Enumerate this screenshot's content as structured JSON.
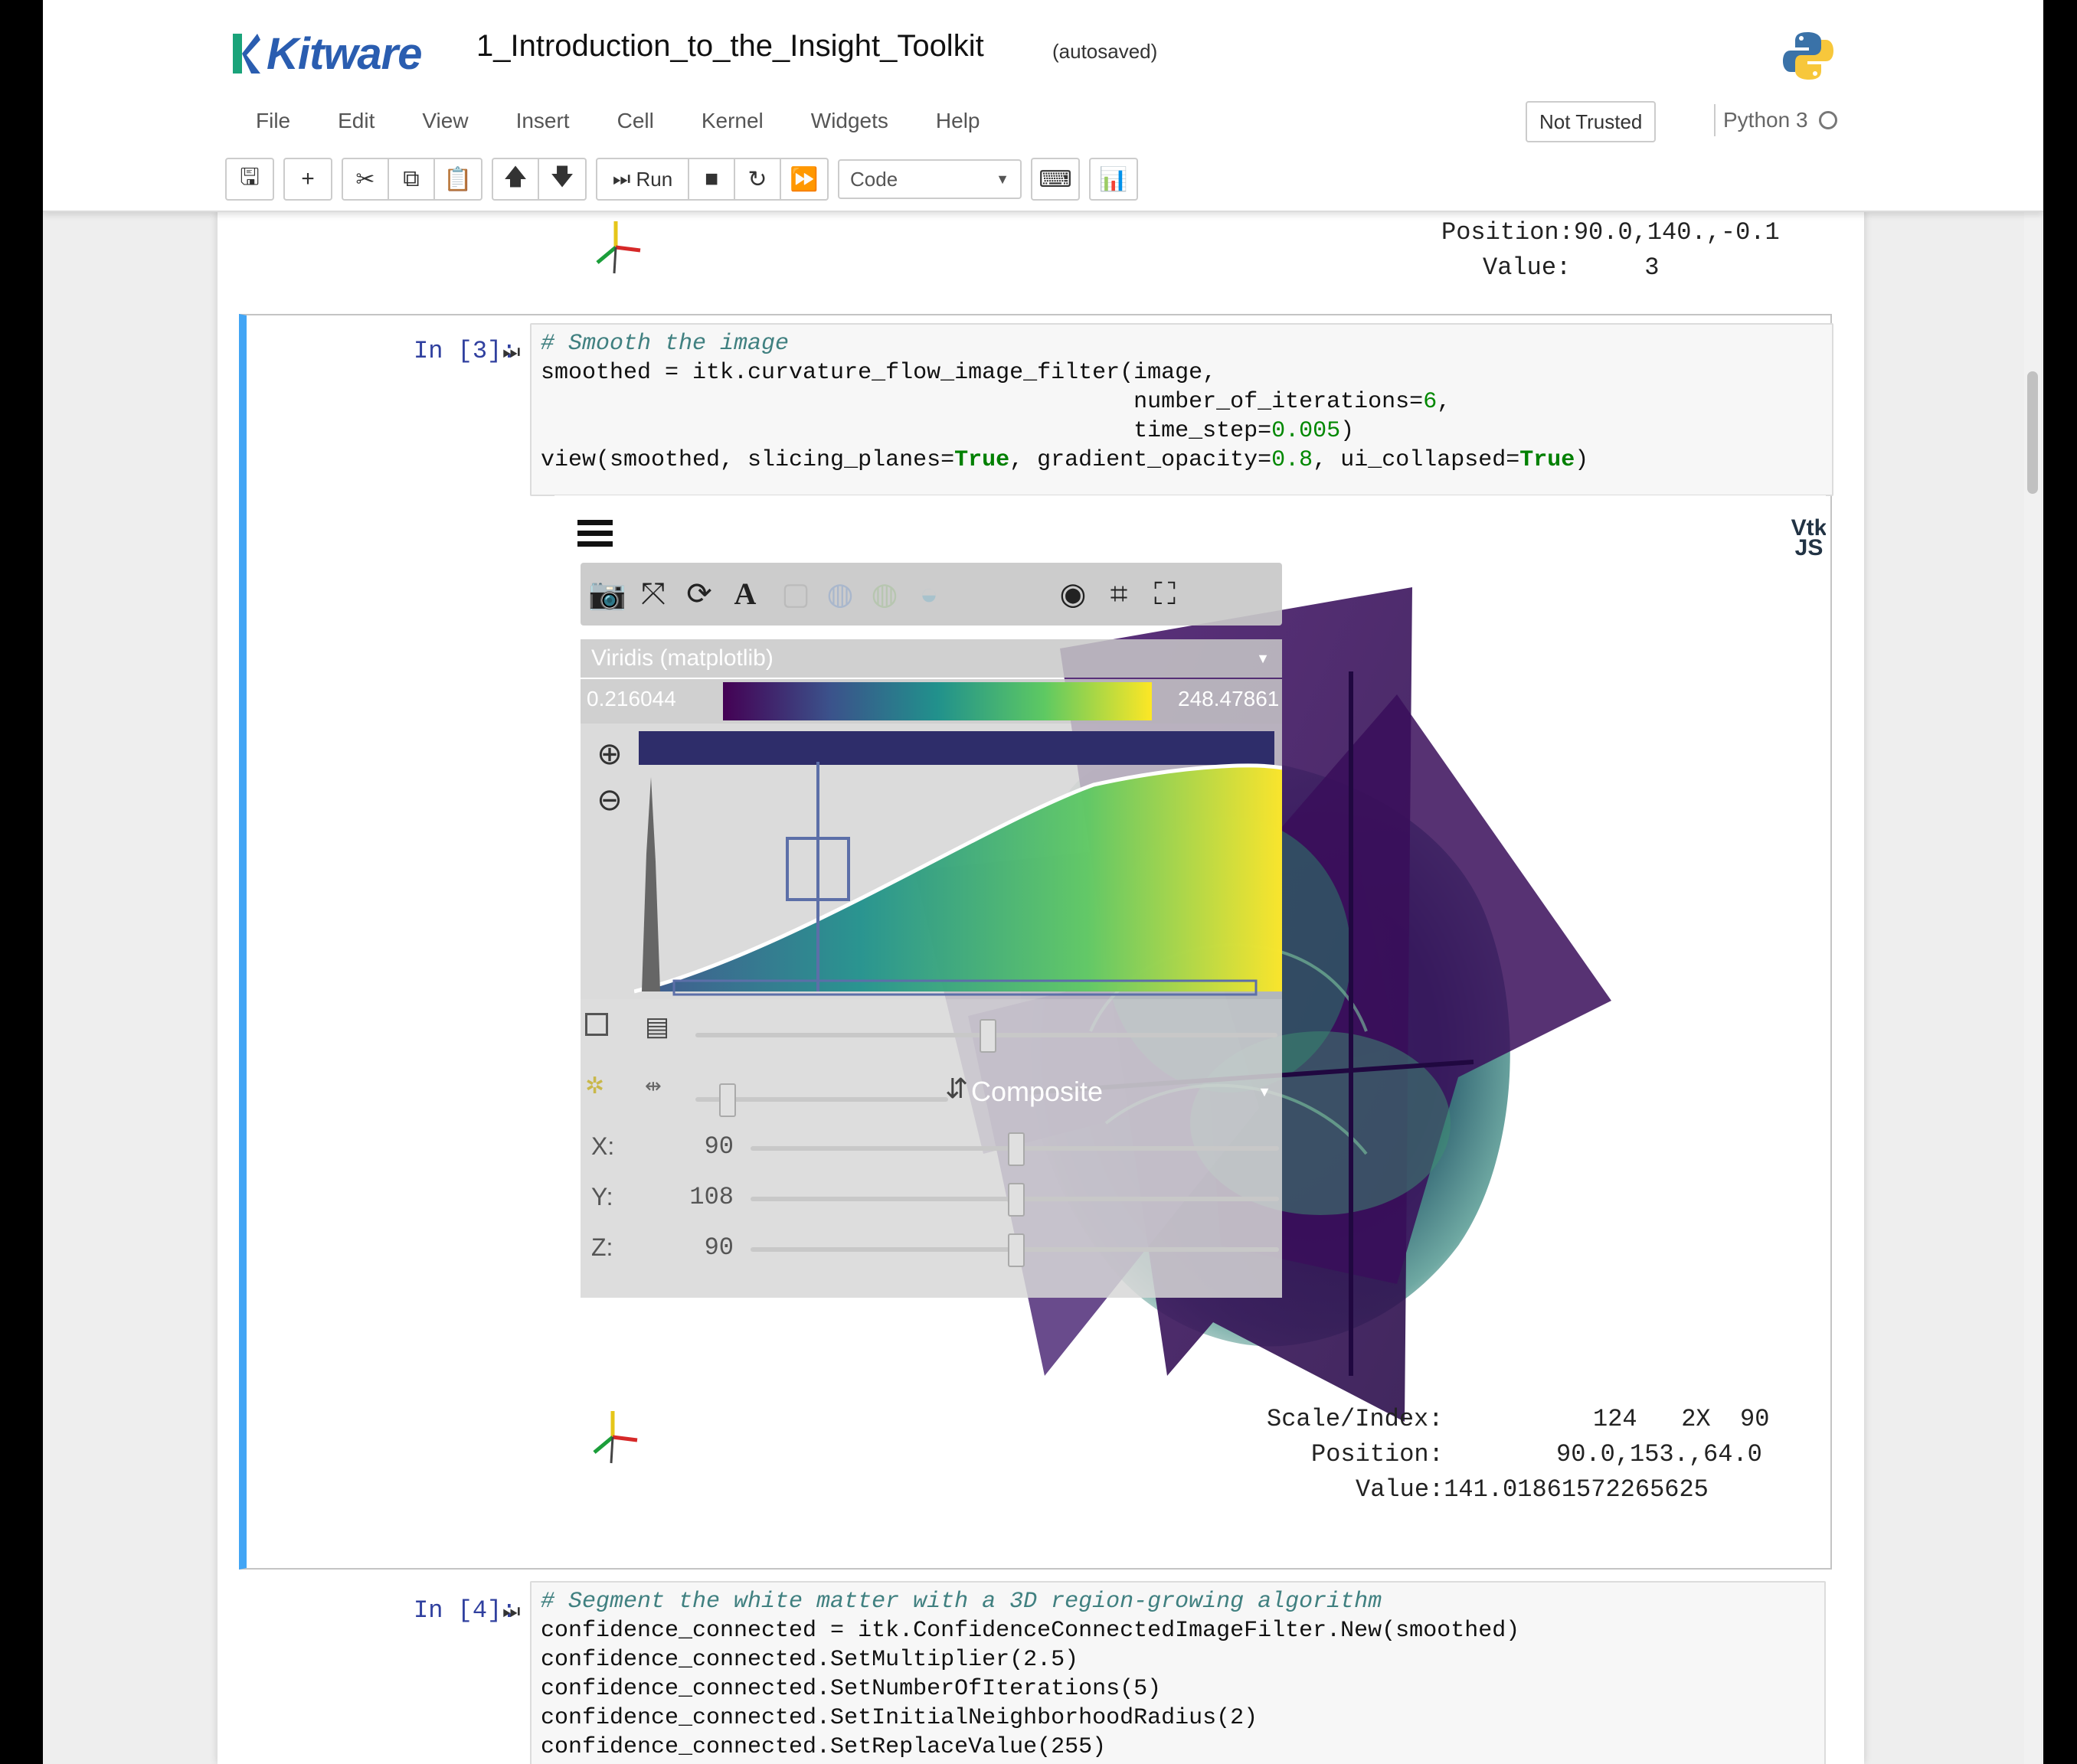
{
  "header": {
    "logo_text": "Kitware",
    "notebook_title": "1_Introduction_to_the_Insight_Toolkit",
    "autosave_status": "(autosaved)",
    "not_trusted": "Not Trusted",
    "kernel_name": "Python 3"
  },
  "menu": [
    "File",
    "Edit",
    "View",
    "Insert",
    "Cell",
    "Kernel",
    "Widgets",
    "Help"
  ],
  "toolbar": {
    "run_label": "Run",
    "cell_type": "Code",
    "icons": [
      "save-icon",
      "plus-icon",
      "cut-icon",
      "copy-icon",
      "paste-icon",
      "arrow-up-icon",
      "arrow-down-icon",
      "run-icon",
      "stop-icon",
      "restart-icon",
      "fast-forward-icon",
      "keyboard-icon",
      "chart-icon"
    ]
  },
  "prev_output": {
    "position": "Position:90.0,140.,-0.1",
    "value": "Value:     3"
  },
  "cell3": {
    "prompt": "In [3]:",
    "code_comment": "# Smooth the image",
    "line2a": "smoothed = itk.curvature_flow_image_filter(image,",
    "line3a": "                                           number_of_iterations=",
    "line3num": "6",
    "line3b": ",",
    "line4a": "                                           time_step=",
    "line4num": "0.005",
    "line4b": ")",
    "line5a": "view(smoothed, slicing_planes=",
    "line5kw1": "True",
    "line5b": ", gradient_opacity=",
    "line5num": "0.8",
    "line5c": ", ui_collapsed=",
    "line5kw2": "True",
    "line5d": ")"
  },
  "viewer": {
    "vtk_logo": "Vtk JS",
    "colormap_name": "Viridis (matplotlib)",
    "range_min": "0.216044",
    "range_max": "248.47861",
    "blend_mode": "Composite",
    "slices": [
      {
        "label": "X:",
        "value": "90",
        "fraction": 0.5
      },
      {
        "label": "Y:",
        "value": "108",
        "fraction": 0.5
      },
      {
        "label": "Z:",
        "value": "90",
        "fraction": 0.5
      }
    ],
    "opacity_fraction": 0.5,
    "sample_fraction": 0.12,
    "scale_index_label": "Scale/Index:",
    "scale_index_value": "124   2X  90",
    "position_label": "Position:",
    "position_value": "90.0,153.,64.0",
    "value_text": "Value:141.01861572265625",
    "colors": {
      "viridis_dark": "#440154",
      "viridis_mid": "#21918c",
      "viridis_light": "#fde725"
    }
  },
  "cell4": {
    "prompt": "In [4]:",
    "lines": [
      "# Segment the white matter with a 3D region-growing algorithm",
      "confidence_connected = itk.ConfidenceConnectedImageFilter.New(smoothed)",
      "confidence_connected.SetMultiplier(2.5)",
      "confidence_connected.SetNumberOfIterations(5)",
      "confidence_connected.SetInitialNeighborhoodRadius(2)",
      "confidence_connected.SetReplaceValue(255)"
    ]
  }
}
